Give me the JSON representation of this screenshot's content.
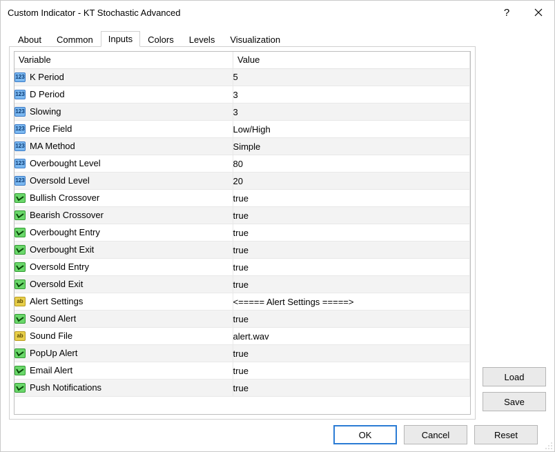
{
  "window": {
    "title": "Custom Indicator - KT Stochastic Advanced"
  },
  "tabs": [
    {
      "label": "About"
    },
    {
      "label": "Common"
    },
    {
      "label": "Inputs",
      "active": true
    },
    {
      "label": "Colors"
    },
    {
      "label": "Levels"
    },
    {
      "label": "Visualization"
    }
  ],
  "grid": {
    "header_variable": "Variable",
    "header_value": "Value",
    "rows": [
      {
        "type": "int",
        "name": "K Period",
        "value": "5"
      },
      {
        "type": "int",
        "name": "D Period",
        "value": "3"
      },
      {
        "type": "int",
        "name": "Slowing",
        "value": "3"
      },
      {
        "type": "int",
        "name": "Price Field",
        "value": "Low/High"
      },
      {
        "type": "int",
        "name": "MA Method",
        "value": "Simple"
      },
      {
        "type": "int",
        "name": "Overbought Level",
        "value": "80"
      },
      {
        "type": "int",
        "name": "Oversold Level",
        "value": "20"
      },
      {
        "type": "bool",
        "name": "Bullish Crossover",
        "value": "true"
      },
      {
        "type": "bool",
        "name": "Bearish Crossover",
        "value": "true"
      },
      {
        "type": "bool",
        "name": "Overbought Entry",
        "value": "true"
      },
      {
        "type": "bool",
        "name": "Overbought Exit",
        "value": "true"
      },
      {
        "type": "bool",
        "name": "Oversold Entry",
        "value": "true"
      },
      {
        "type": "bool",
        "name": "Oversold Exit",
        "value": "true"
      },
      {
        "type": "str",
        "name": "Alert Settings",
        "value": "<===== Alert Settings =====>"
      },
      {
        "type": "bool",
        "name": "Sound Alert",
        "value": "true"
      },
      {
        "type": "str",
        "name": "Sound File",
        "value": "alert.wav"
      },
      {
        "type": "bool",
        "name": "PopUp Alert",
        "value": "true"
      },
      {
        "type": "bool",
        "name": "Email Alert",
        "value": "true"
      },
      {
        "type": "bool",
        "name": "Push Notifications",
        "value": "true"
      }
    ]
  },
  "buttons": {
    "load": "Load",
    "save": "Save",
    "ok": "OK",
    "cancel": "Cancel",
    "reset": "Reset"
  }
}
